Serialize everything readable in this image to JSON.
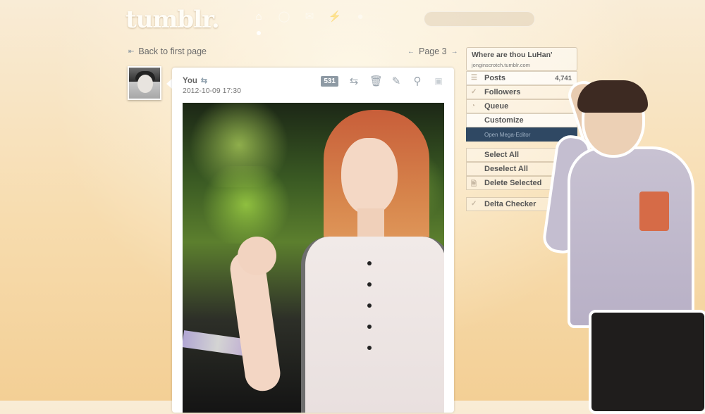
{
  "header": {
    "logo": "tumblr.",
    "nav_icons": [
      "home-icon",
      "explore-icon",
      "inbox-icon",
      "activity-icon",
      "account-icon"
    ],
    "search_placeholder": ""
  },
  "navigation": {
    "back_label": "Back to first page",
    "page_label": "Page 3"
  },
  "post": {
    "author": "You",
    "date": "2012-10-09 17:30",
    "notes_count": "531",
    "controls": [
      "reblog-icon",
      "delete-icon",
      "edit-icon",
      "zoom-icon",
      "select-icon"
    ]
  },
  "sidebar": {
    "blog_title": "Where are thou LuHan'",
    "blog_url": "jonginscrotch.tumblr.com",
    "items": [
      {
        "label": "Posts",
        "count": "4,741",
        "icon": "posts-icon"
      },
      {
        "label": "Followers",
        "count": "",
        "icon": "followers-icon"
      },
      {
        "label": "Queue",
        "count": "",
        "icon": "queue-icon"
      },
      {
        "label": "Customize",
        "count": "",
        "icon": ""
      }
    ],
    "mega_editor_label": "Open Mega-Editor",
    "actions": [
      {
        "label": "Select All",
        "icon": ""
      },
      {
        "label": "Deselect All",
        "icon": ""
      },
      {
        "label": "Delete Selected",
        "icon": "delete-doc-icon"
      }
    ],
    "delta_checker_label": "Delta Checker"
  },
  "colors": {
    "background": "#f7dcae",
    "mega_editor_bg": "#2f4863",
    "text": "#555555"
  }
}
